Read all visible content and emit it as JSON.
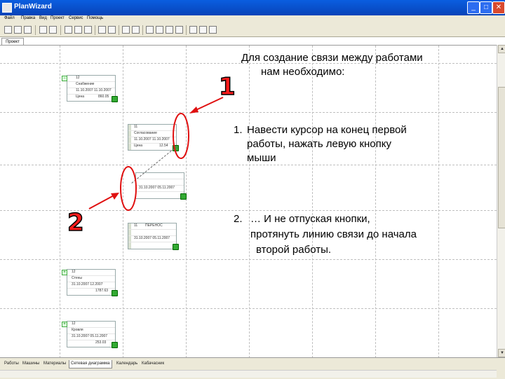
{
  "window": {
    "title": "PlanWizard",
    "minimize": "_",
    "maximize": "□",
    "close": "✕"
  },
  "menu": [
    "Файл",
    "Правка",
    "Вид",
    "Проект",
    "Сервис",
    "Помощь"
  ],
  "doc_tab": "Проект",
  "instructions": {
    "heading_line1": "Для создание связи между работами",
    "heading_line2": "нам необходимо:",
    "step1_num": "1.",
    "step1_line1": "Навести курсор на конец первой",
    "step1_line2": "работы, нажать левую кнопку",
    "step1_line3": "мыши",
    "step2_num": "2.",
    "step2_line1": "… И не отпуская кнопки,",
    "step2_line2": "протянуть линию связи до начала",
    "step2_line3": "второй работы."
  },
  "markers": {
    "one": "1",
    "two": "2"
  },
  "cards": [
    {
      "id": "12",
      "name": "Снабжение",
      "dates": "11.10.2007  11.10.2007",
      "cost_label": "Цена",
      "cost": "860.05",
      "toggle": "−"
    },
    {
      "id": "11",
      "name": "Согласование",
      "dates": "11.10.2007  11.10.2007",
      "cost_label": "Цена",
      "cost": "12.54",
      "toggle": ""
    },
    {
      "id": "",
      "name": "",
      "dates": "31.10.2007  05.11.2007",
      "cost_label": "",
      "cost": "",
      "toggle": ""
    },
    {
      "id": "11",
      "name": "ПЕРЕНОС",
      "dates": "31.10.2007  05.11.2007",
      "cost_label": "",
      "cost": "",
      "toggle": ""
    },
    {
      "id": "12",
      "name": "Стены",
      "dates": "31.10.2007  12.2007",
      "cost_label": "",
      "cost": "1787.63",
      "toggle": "+"
    },
    {
      "id": "12",
      "name": "Кровля",
      "dates": "31.10.2007  05.11.2007",
      "cost_label": "",
      "cost": "253.03",
      "toggle": "+"
    }
  ],
  "bottom_tabs": [
    "Работы",
    "Машины",
    "Материалы",
    "Сетевая диаграмма",
    "Календарь",
    "Кабачасник"
  ],
  "active_bottom_tab": "Сетевая диаграмма",
  "colors": {
    "annotation_red": "#ff1b1b",
    "titlebar_blue": "#0a5ee0",
    "window_bg": "#ece9d8"
  },
  "icons": [
    "app-icon",
    "new-icon",
    "open-icon",
    "save-icon",
    "print-icon",
    "cut-icon",
    "copy-icon",
    "paste-icon",
    "undo-icon",
    "redo-icon",
    "zoom-icon",
    "grid-icon",
    "check-icon"
  ]
}
